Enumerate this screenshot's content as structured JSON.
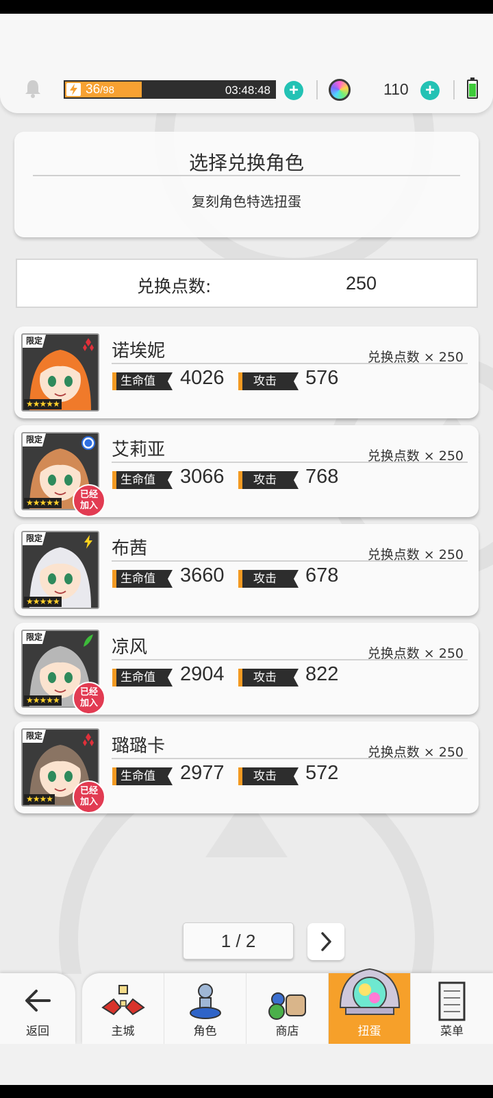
{
  "topbar": {
    "stamina_current": "36",
    "stamina_max": "/98",
    "stamina_fraction": 0.367,
    "stamina_timer": "03:48:48",
    "gem_count": "110",
    "plus_symbol": "+"
  },
  "header": {
    "title": "选择兑换角色",
    "subtitle": "复刻角色特选扭蛋"
  },
  "points": {
    "label": "兑换点数:",
    "value": "250"
  },
  "stat_labels": {
    "hp": "生命值",
    "atk": "攻击"
  },
  "badges": {
    "limited": "限定",
    "joined_line1": "已经",
    "joined_line2": "加入"
  },
  "characters": [
    {
      "name": "诺埃妮",
      "cost": "兑换点数 × 250",
      "hp": "4026",
      "atk": "576",
      "stars": "★★★★★",
      "element": "red-diamond-icon",
      "joined": false,
      "portrait_color": "#f07a2a"
    },
    {
      "name": "艾莉亚",
      "cost": "兑换点数 × 250",
      "hp": "3066",
      "atk": "768",
      "stars": "★★★★★",
      "element": "blue-circle-icon",
      "joined": true,
      "portrait_color": "#d28a55"
    },
    {
      "name": "布茜",
      "cost": "兑换点数 × 250",
      "hp": "3660",
      "atk": "678",
      "stars": "★★★★★",
      "element": "yellow-bolt-icon",
      "joined": false,
      "portrait_color": "#e9e9ee"
    },
    {
      "name": "凉风",
      "cost": "兑换点数 × 250",
      "hp": "2904",
      "atk": "822",
      "stars": "★★★★★",
      "element": "green-leaf-icon",
      "joined": true,
      "portrait_color": "#b7b7b7"
    },
    {
      "name": "璐璐卡",
      "cost": "兑换点数 × 250",
      "hp": "2977",
      "atk": "572",
      "stars": "★★★★",
      "element": "red-diamond-icon",
      "joined": true,
      "portrait_color": "#8a7463"
    }
  ],
  "pagination": {
    "label": "1 / 2"
  },
  "nav": {
    "back": "返回",
    "items": [
      {
        "label": "主城",
        "icon": "castle-icon",
        "active": false
      },
      {
        "label": "角色",
        "icon": "character-icon",
        "active": false
      },
      {
        "label": "商店",
        "icon": "shop-icon",
        "active": false
      },
      {
        "label": "扭蛋",
        "icon": "gacha-icon",
        "active": true
      },
      {
        "label": "菜单",
        "icon": "menu-icon",
        "active": false
      }
    ]
  },
  "colors": {
    "accent_orange": "#f6a02a",
    "plus_teal": "#23c2b4",
    "joined_red": "#e23b52"
  }
}
